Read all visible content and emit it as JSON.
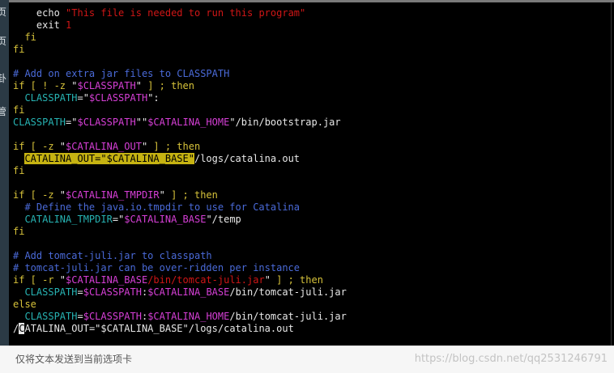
{
  "left_panel": {
    "chars": [
      "页",
      "页",
      "卦",
      "管"
    ]
  },
  "terminal": {
    "lines": [
      [
        {
          "t": "    echo ",
          "c": "def"
        },
        {
          "t": "\"This file is needed to run this program\"",
          "c": "str"
        }
      ],
      [
        {
          "t": "    exit ",
          "c": "def"
        },
        {
          "t": "1",
          "c": "str"
        }
      ],
      [
        {
          "t": "  fi",
          "c": "kw"
        }
      ],
      [
        {
          "t": "fi",
          "c": "kw"
        }
      ],
      [],
      [
        {
          "t": "# Add on extra jar files to CLASSPATH",
          "c": "cmt"
        }
      ],
      [
        {
          "t": "if [ ! -z ",
          "c": "kw"
        },
        {
          "t": "\"",
          "c": "def"
        },
        {
          "t": "$CLASSPATH",
          "c": "var"
        },
        {
          "t": "\"",
          "c": "def"
        },
        {
          "t": " ] ; then",
          "c": "kw"
        }
      ],
      [
        {
          "t": "  CLASSPATH",
          "c": "id"
        },
        {
          "t": "=\"",
          "c": "def"
        },
        {
          "t": "$CLASSPATH",
          "c": "var"
        },
        {
          "t": "\":",
          "c": "def"
        }
      ],
      [
        {
          "t": "fi",
          "c": "kw"
        }
      ],
      [
        {
          "t": "CLASSPATH",
          "c": "id"
        },
        {
          "t": "=\"",
          "c": "def"
        },
        {
          "t": "$CLASSPATH",
          "c": "var"
        },
        {
          "t": "\"\"",
          "c": "def"
        },
        {
          "t": "$CATALINA_HOME",
          "c": "var"
        },
        {
          "t": "\"/bin/bootstrap.jar",
          "c": "def"
        }
      ],
      [],
      [
        {
          "t": "if [ -z ",
          "c": "kw"
        },
        {
          "t": "\"",
          "c": "def"
        },
        {
          "t": "$CATALINA_OUT",
          "c": "var"
        },
        {
          "t": "\"",
          "c": "def"
        },
        {
          "t": " ] ; then",
          "c": "kw"
        }
      ],
      [
        {
          "t": "  ",
          "c": "def"
        },
        {
          "t": "CATALINA_OUT=\"$CATALINA_BASE\"",
          "c": "hl"
        },
        {
          "t": "/logs/catalina.out",
          "c": "def"
        }
      ],
      [
        {
          "t": "fi",
          "c": "kw"
        }
      ],
      [],
      [
        {
          "t": "if [ -z ",
          "c": "kw"
        },
        {
          "t": "\"",
          "c": "def"
        },
        {
          "t": "$CATALINA_TMPDIR",
          "c": "var"
        },
        {
          "t": "\"",
          "c": "def"
        },
        {
          "t": " ] ; then",
          "c": "kw"
        }
      ],
      [
        {
          "t": "  # Define the java.io.tmpdir to use for Catalina",
          "c": "cmt"
        }
      ],
      [
        {
          "t": "  CATALINA_TMPDIR",
          "c": "id"
        },
        {
          "t": "=\"",
          "c": "def"
        },
        {
          "t": "$CATALINA_BASE",
          "c": "var"
        },
        {
          "t": "\"/temp",
          "c": "def"
        }
      ],
      [
        {
          "t": "fi",
          "c": "kw"
        }
      ],
      [],
      [
        {
          "t": "# Add tomcat-juli.jar to classpath",
          "c": "cmt"
        }
      ],
      [
        {
          "t": "# tomcat-juli.jar can be over-ridden per instance",
          "c": "cmt"
        }
      ],
      [
        {
          "t": "if [ -r ",
          "c": "kw"
        },
        {
          "t": "\"",
          "c": "def"
        },
        {
          "t": "$CATALINA_BASE",
          "c": "var"
        },
        {
          "t": "/bin/tomcat-juli.jar",
          "c": "str"
        },
        {
          "t": "\"",
          "c": "def"
        },
        {
          "t": " ] ; then",
          "c": "kw"
        }
      ],
      [
        {
          "t": "  CLASSPATH",
          "c": "id"
        },
        {
          "t": "=",
          "c": "def"
        },
        {
          "t": "$CLASSPATH",
          "c": "var"
        },
        {
          "t": ":",
          "c": "def"
        },
        {
          "t": "$CATALINA_BASE",
          "c": "var"
        },
        {
          "t": "/bin/tomcat-juli.jar",
          "c": "def"
        }
      ],
      [
        {
          "t": "else",
          "c": "kw"
        }
      ],
      [
        {
          "t": "  CLASSPATH",
          "c": "id"
        },
        {
          "t": "=",
          "c": "def"
        },
        {
          "t": "$CLASSPATH",
          "c": "var"
        },
        {
          "t": ":",
          "c": "def"
        },
        {
          "t": "$CATALINA_HOME",
          "c": "var"
        },
        {
          "t": "/bin/tomcat-juli.jar",
          "c": "def"
        }
      ],
      [
        {
          "t": "/",
          "c": "def"
        },
        {
          "t": "C",
          "c": "cursor"
        },
        {
          "t": "ATALINA_OUT=\"$CATALINA_BASE\"/logs/catalina.out",
          "c": "def"
        }
      ]
    ]
  },
  "status_bar": {
    "text": "仅将文本发送到当前选项卡",
    "watermark": "https://blog.csdn.net/qq2531246791"
  }
}
